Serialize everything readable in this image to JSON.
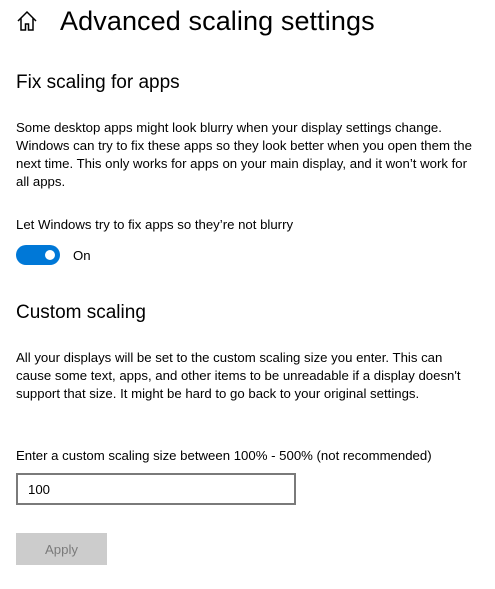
{
  "header": {
    "home_icon": "home-icon",
    "title": "Advanced scaling settings"
  },
  "fix_scaling": {
    "heading": "Fix scaling for apps",
    "description": "Some desktop apps might look blurry when your display settings change. Windows can try to fix these apps so they look better when you open them the next time. This only works for apps on your main display, and it won’t work for all apps.",
    "toggle_label": "Let Windows try to fix apps so they’re not blurry",
    "toggle_state": "On",
    "toggle_on": true,
    "accent_color": "#0078d7"
  },
  "custom_scaling": {
    "heading": "Custom scaling",
    "description": "All your displays will be set to the custom scaling size you enter. This can cause some text, apps, and other items to be unreadable if a display doesn't support that size. It might be hard to go back to your original settings.",
    "input_label": "Enter a custom scaling size between 100% - 500% (not recommended)",
    "input_value": "100",
    "apply_label": "Apply",
    "apply_enabled": false
  }
}
